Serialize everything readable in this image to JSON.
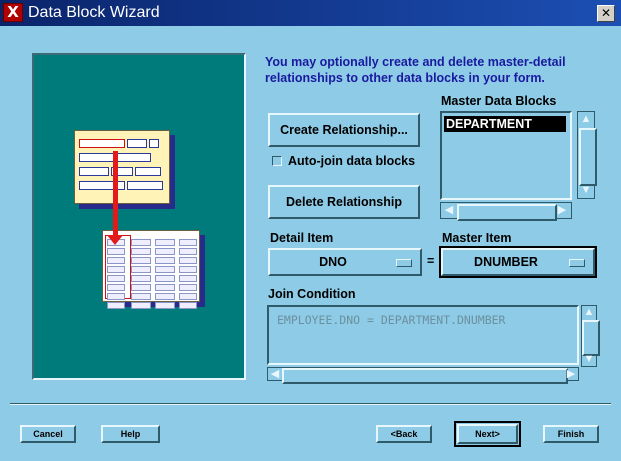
{
  "window": {
    "title": "Data Block Wizard",
    "logo_glyph": "X",
    "close_glyph": "✕"
  },
  "intro_text": "You may optionally create and delete master-detail relationships to other data blocks in your form.",
  "buttons": {
    "create_relationship": "Create Relationship...",
    "delete_relationship": "Delete Relationship",
    "cancel": "Cancel",
    "help": "Help",
    "back": "<Back",
    "next": "Next>",
    "finish": "Finish"
  },
  "auto_join": {
    "label": "Auto-join data blocks",
    "checked": false
  },
  "master_blocks": {
    "label": "Master Data Blocks",
    "items": [
      "DEPARTMENT"
    ],
    "selected_index": 0
  },
  "detail_item": {
    "label": "Detail Item",
    "value": "DNO"
  },
  "equals_sign": "=",
  "master_item": {
    "label": "Master Item",
    "value": "DNUMBER"
  },
  "join_condition": {
    "label": "Join Condition",
    "value": "EMPLOYEE.DNO = DEPARTMENT.DNUMBER"
  },
  "colors": {
    "background": "#8ecbe6",
    "titlebar": "#0a246a",
    "illustration_bg": "#007b7b",
    "intro_text": "#1a1aa0",
    "arrow": "#e21a1a"
  }
}
